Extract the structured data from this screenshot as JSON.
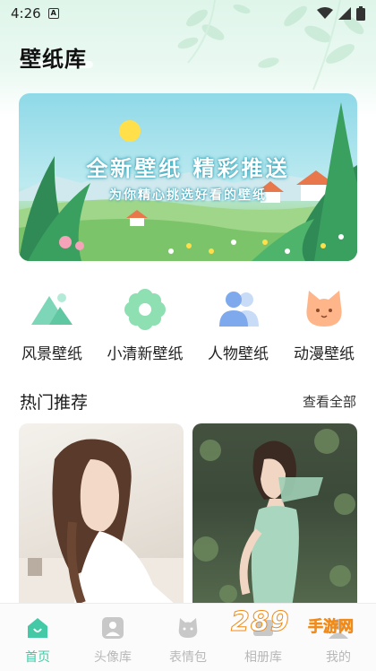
{
  "status_bar": {
    "time": "4:26",
    "app_badge": "A"
  },
  "header": {
    "title": "壁纸库"
  },
  "banner": {
    "title": "全新壁纸 精彩推送",
    "subtitle": "为你精心挑选好看的壁纸"
  },
  "categories": [
    {
      "label": "风景壁纸",
      "icon": "mountain-icon"
    },
    {
      "label": "小清新壁纸",
      "icon": "flower-icon"
    },
    {
      "label": "人物壁纸",
      "icon": "people-icon"
    },
    {
      "label": "动漫壁纸",
      "icon": "cat-icon"
    }
  ],
  "section": {
    "title": "热门推荐",
    "more": "查看全部"
  },
  "tabs": [
    {
      "label": "首页",
      "icon": "home-icon",
      "active": true
    },
    {
      "label": "头像库",
      "icon": "avatar-icon",
      "active": false
    },
    {
      "label": "表情包",
      "icon": "emoji-icon",
      "active": false
    },
    {
      "label": "相册库",
      "icon": "album-icon",
      "active": false
    },
    {
      "label": "我的",
      "icon": "profile-icon",
      "active": false
    }
  ],
  "watermark": {
    "logo": "289",
    "suffix": "手游网"
  },
  "colors": {
    "accent": "#43c9a6",
    "inactive": "#b8b8b8",
    "title_glow": "#2f9fb3",
    "watermark": "#f08a18"
  }
}
